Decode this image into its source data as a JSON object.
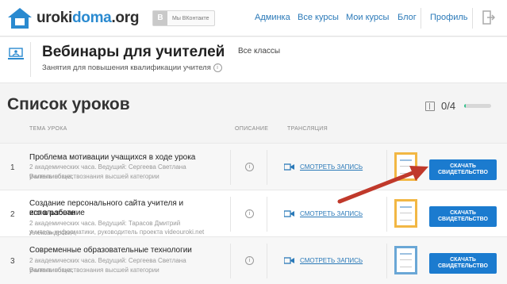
{
  "topbar": {
    "logo": {
      "part1": "uroki",
      "part2": "doma",
      "part3": ".org"
    },
    "vk_label": "Мы ВКонтакте",
    "nav": [
      "Админка",
      "Все курсы",
      "Мои курсы",
      "Блог",
      "Профиль"
    ]
  },
  "header": {
    "title": "Вебинары для учителей",
    "class_label": "Все классы",
    "subtitle": "Занятия для повышения квалификации учителя"
  },
  "lessons": {
    "heading": "Список уроков",
    "progress_text": "0/4",
    "progress_fraction": 0.05,
    "columns": {
      "topic": "ТЕМА УРОКА",
      "description": "ОПИСАНИЕ",
      "broadcast": "ТРАНСЛЯЦИЯ"
    },
    "watch_label": "СМОТРЕТЬ ЗАПИСЬ",
    "cert_line1": "СКАЧАТЬ",
    "cert_line2": "СВИДЕТЕЛЬСТВО",
    "rows": [
      {
        "num": "1",
        "title": "Проблема мотивации учащихся в ходе урока",
        "desc1": "2 академических часа. Ведущий: Сергеева Светлана Валентиновна,",
        "desc2": "учитель обществознания высшей категории",
        "desc3": ""
      },
      {
        "num": "2",
        "title": "Создание персонального сайта учителя и использование",
        "title2": "его в работе",
        "desc1": "2 академических часа. Ведущий: Тарасов Дмитрий Александрович,",
        "desc2": "учитель информатики, руководитель проекта videouroki.net",
        "desc3": ""
      },
      {
        "num": "3",
        "title": "Современные образовательные технологии",
        "desc1": "2 академических часа. Ведущий: Сергеева Светлана Валентиновна,",
        "desc2": "учитель обществознания высшей категории",
        "desc3": ""
      }
    ]
  },
  "colors": {
    "accent": "#1b7bcf",
    "link": "#2a79b8",
    "progress": "#2fc28a",
    "arrow": "#c0392b"
  },
  "icons": [
    "house-logo-icon",
    "exit-icon",
    "webinar-icon",
    "info-icon",
    "book-icon",
    "camera-icon",
    "certificate-thumbnail"
  ]
}
